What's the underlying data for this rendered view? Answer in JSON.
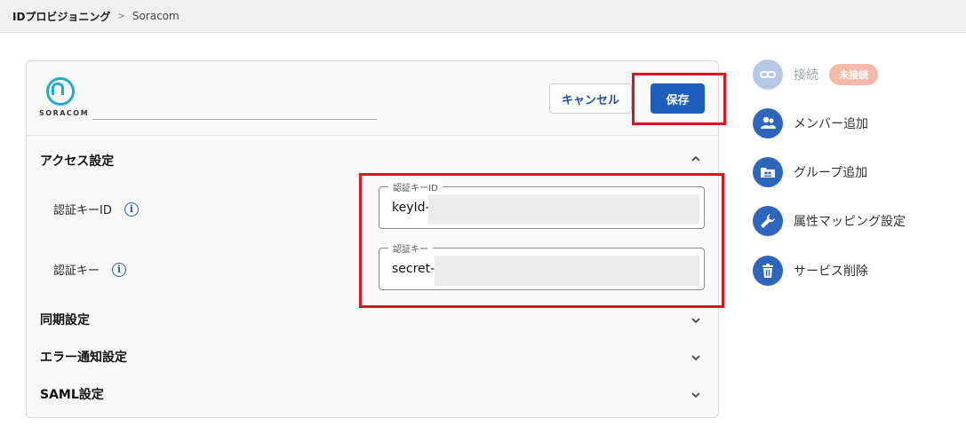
{
  "breadcrumb": {
    "root": "IDプロビジョニング",
    "separator": ">",
    "current": "Soracom"
  },
  "card": {
    "logo_text": "SORACOM",
    "cancel_label": "キャンセル",
    "save_label": "保存"
  },
  "sections": {
    "access": {
      "title": "アクセス設定",
      "fields": [
        {
          "label": "認証キーID",
          "legend": "認証キーID",
          "value": "keyId-"
        },
        {
          "label": "認証キー",
          "legend": "認証キー",
          "value": "secret-"
        }
      ]
    },
    "sync": {
      "title": "同期設定"
    },
    "error_notify": {
      "title": "エラー通知設定"
    },
    "saml": {
      "title": "SAML設定"
    }
  },
  "side_menu": [
    {
      "label": "接続",
      "icon": "link-icon",
      "badge": "未接続",
      "disabled": true
    },
    {
      "label": "メンバー追加",
      "icon": "add-member-icon"
    },
    {
      "label": "グループ追加",
      "icon": "add-group-icon"
    },
    {
      "label": "属性マッピング設定",
      "icon": "wrench-icon"
    },
    {
      "label": "サービス削除",
      "icon": "trash-icon"
    }
  ],
  "colors": {
    "primary": "#1f5dbb",
    "highlight": "#e0141e",
    "logo": "#2aa9c7",
    "badge": "#f5b9aa"
  }
}
